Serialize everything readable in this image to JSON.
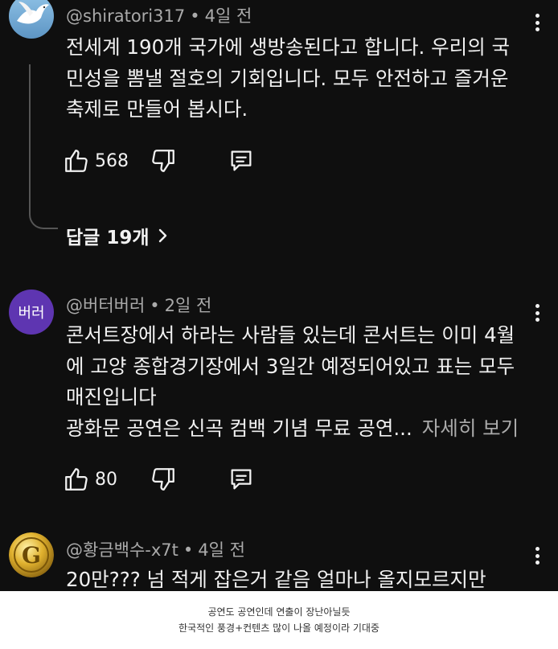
{
  "comments": [
    {
      "avatar_icon": "dove-avatar-icon",
      "author": "@shiratori317",
      "time": "4일 전",
      "lines": [
        "전세계 190개 국가에 생방송된다고 합니다. 우리의 국",
        "민성을 뽐낼 절호의 기회입니다. 모두 안전하고 즐거운",
        "축제로 만들어 봅시다."
      ],
      "likes": "568",
      "replies_label": "답글 19개"
    },
    {
      "avatar_text": "버러",
      "avatar_color": "#5e35b1",
      "author": "@버터버러",
      "time": "2일 전",
      "lines": [
        "콘서트장에서 하라는 사람들 있는데 콘서트는 이미 4월",
        "에 고양 종합경기장에서 3일간 예정되어있고 표는 모두",
        "매진입니다",
        "광화문 공연은 신곡 컴백 기념 무료 공연..."
      ],
      "more_label": "자세히 보기",
      "likes": "80"
    },
    {
      "avatar_icon": "gold-coin-g-avatar-icon",
      "author": "@황금백수-x7t",
      "time": "4일 전",
      "lines": [
        "20만??? 넘 적게 잡은거 같음 얼마나 올지모르지만"
      ]
    }
  ],
  "caption": {
    "line1": "공연도 공연인데 연출이 장난아닐듯",
    "line2": "한국적인 풍경+컨텐츠 많이 나올 예정이라 기대중"
  },
  "colors": {
    "background": "#0f0f0f",
    "text": "#f1f1f1",
    "secondary_text": "#aaaaaa",
    "caption_bg": "#ffffff"
  }
}
